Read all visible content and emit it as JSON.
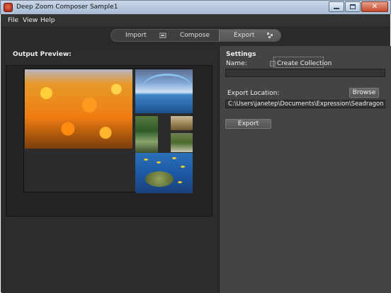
{
  "window": {
    "title": "Deep Zoom Composer Sample1"
  },
  "menu": {
    "items": [
      "File",
      "View",
      "Help"
    ]
  },
  "workflow_tabs": {
    "items": [
      {
        "label": "Import",
        "icon": "import-icon"
      },
      {
        "label": "Compose",
        "icon": "compose-icon"
      },
      {
        "label": "Export",
        "icon": "export-icon",
        "selected": true
      }
    ]
  },
  "output_preview": {
    "heading": "Output Preview:",
    "images": [
      "sunflowers",
      "ocean-wave",
      "forest-path",
      "savanna-tree",
      "trees-field",
      "sea-turtle"
    ]
  },
  "settings": {
    "heading": "Settings",
    "name_label": "Name:",
    "name_value": "",
    "create_collection_label": "Create Collection",
    "create_collection_checked": false,
    "export_location_label": "Export Location:",
    "export_location_value": "C:\\Users\\janetep\\Documents\\Expression\\Seadragon",
    "browse_label": "Browse",
    "export_label": "Export"
  },
  "colors": {
    "app_background": "#2a2a2a",
    "settings_background": "#444444",
    "selected_tab": "#5e5e5e"
  }
}
